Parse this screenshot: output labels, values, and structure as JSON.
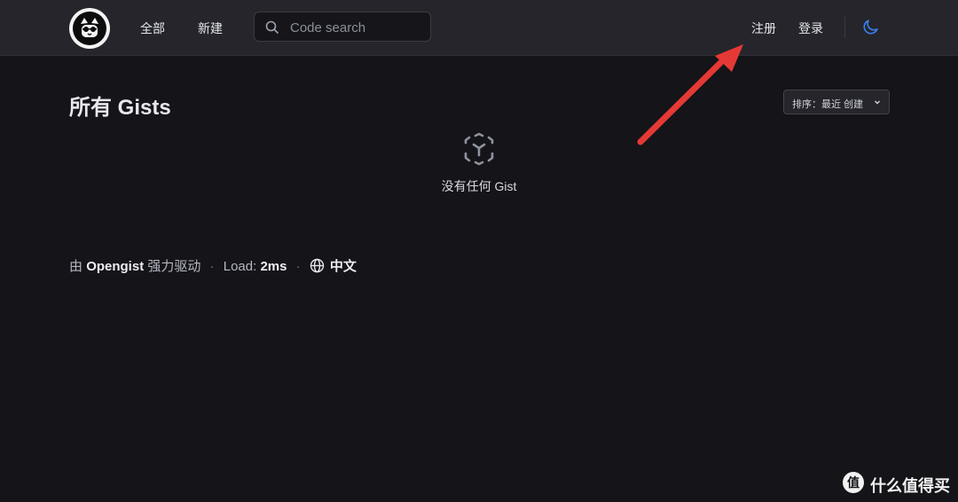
{
  "nav": {
    "all_label": "全部",
    "new_label": "新建",
    "search_placeholder": "Code search",
    "register_label": "注册",
    "login_label": "登录"
  },
  "main": {
    "title": "所有 Gists",
    "sort_label": "排序：最近 创建",
    "empty_text": "没有任何 Gist"
  },
  "footer": {
    "by": "由",
    "brand": "Opengist",
    "powered": "强力驱动",
    "sep": "·",
    "load_label": "Load:",
    "load_value": "2ms",
    "language": "中文"
  },
  "watermark": {
    "text": "什么值得买"
  },
  "colors": {
    "background": "#151418",
    "topbar": "#25252b",
    "accent_moon": "#3b82f6",
    "annotation_arrow": "#e53935"
  },
  "icons": [
    "logo-icon",
    "search-icon",
    "moon-icon",
    "empty-gist-icon",
    "globe-icon",
    "chevron-down-icon"
  ]
}
